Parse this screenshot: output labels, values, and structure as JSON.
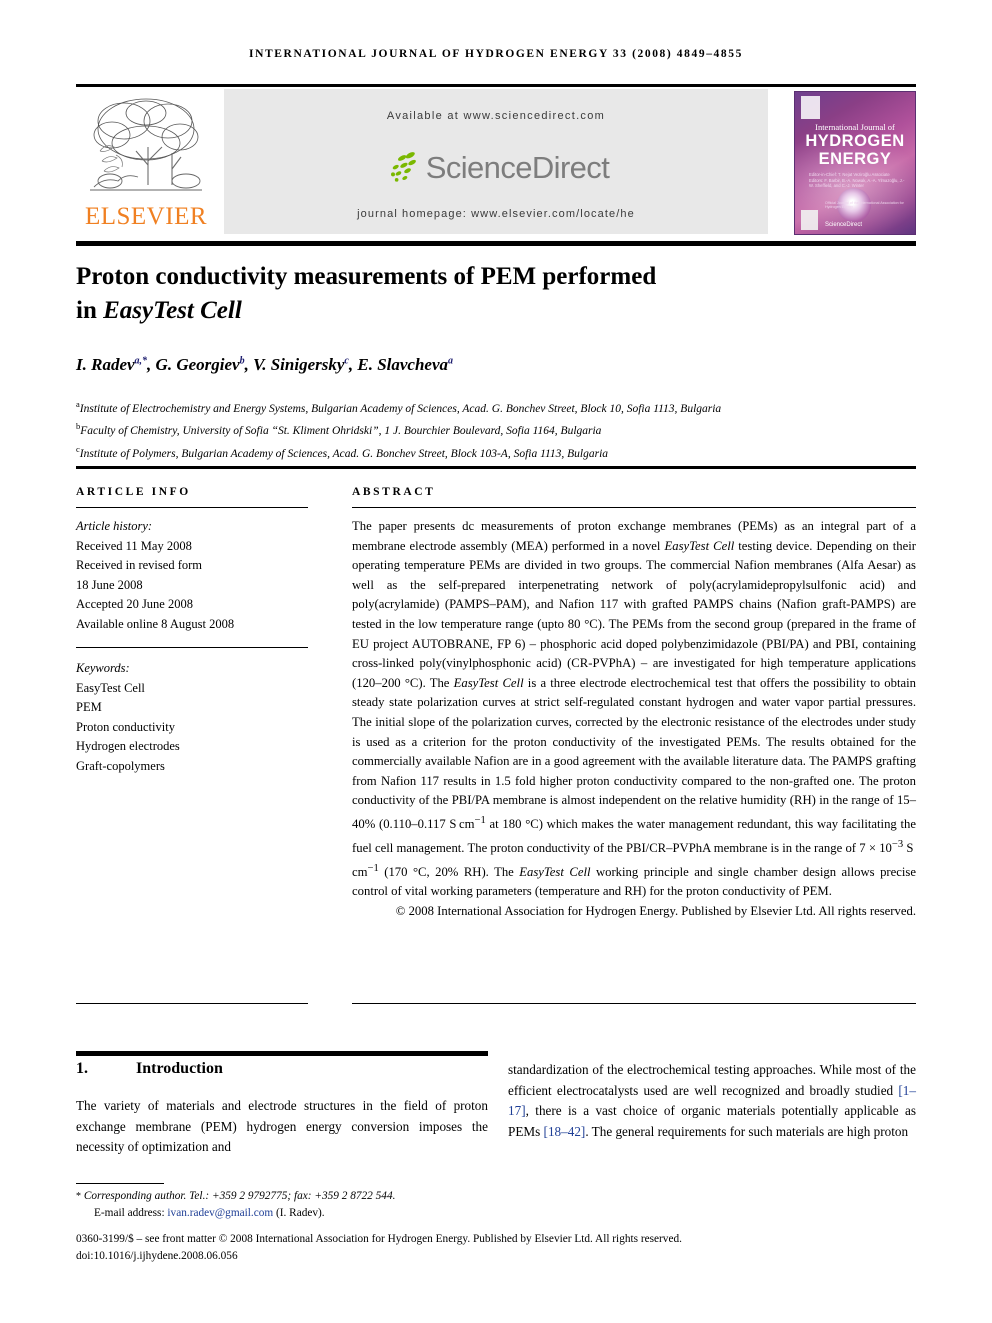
{
  "running_head": "International Journal of Hydrogen Energy 33 (2008) 4849–4855",
  "masthead": {
    "available_at": "Available at www.sciencedirect.com",
    "sciencedirect_logo_text": "ScienceDirect",
    "journal_homepage": "journal homepage: www.elsevier.com/locate/he",
    "publisher_logo_text": "ELSEVIER",
    "publisher_accent": "#f08022",
    "cover": {
      "overline": "International Journal of",
      "line1": "HYDROGEN",
      "line2": "ENERGY",
      "editors": "Editor-in-Chief:  T. Nejat Veziroğlu    Associate Editors: F. Barbir, B.-A. Nowak, A.-A. Ylmazoğlu, J.-W. Sheffield, and C.-J. Winter",
      "bottom_note": "Official Journal of the International Association for Hydrogen Energy",
      "bottom_logo_text": "ScienceDirect",
      "background_color": "#8a3f86"
    }
  },
  "article": {
    "title_line1": "Proton conductivity measurements of PEM performed",
    "title_line2_prefix": "in ",
    "title_line2_italic": "EasyTest Cell",
    "authors": [
      {
        "name": "I. Radev",
        "sup": "a,*"
      },
      {
        "name": "G. Georgiev",
        "sup": "b"
      },
      {
        "name": "V. Sinigersky",
        "sup": "c"
      },
      {
        "name": "E. Slavcheva",
        "sup": "a"
      }
    ],
    "affiliations": [
      {
        "marker": "a",
        "text": "Institute of Electrochemistry and Energy Systems, Bulgarian Academy of Sciences, Acad. G. Bonchev Street, Block 10, Sofia 1113, Bulgaria"
      },
      {
        "marker": "b",
        "text": "Faculty of Chemistry, University of Sofia “St. Kliment Ohridski”, 1 J. Bourchier Boulevard, Sofia 1164, Bulgaria"
      },
      {
        "marker": "c",
        "text": "Institute of Polymers, Bulgarian Academy of Sciences, Acad. G. Bonchev Street, Block 103-A, Sofia 1113, Bulgaria"
      }
    ]
  },
  "article_info": {
    "heading": "ARTICLE INFO",
    "history_label": "Article history:",
    "history": [
      "Received 11 May 2008",
      "Received in revised form",
      "18 June 2008",
      "Accepted 20 June 2008",
      "Available online 8 August 2008"
    ],
    "keywords_label": "Keywords:",
    "keywords": [
      "EasyTest Cell",
      "PEM",
      "Proton conductivity",
      "Hydrogen electrodes",
      "Graft-copolymers"
    ]
  },
  "abstract": {
    "heading": "ABSTRACT",
    "part1": "The paper presents dc measurements of proton exchange membranes (PEMs) as an integral part of a membrane electrode assembly (MEA) performed in a novel ",
    "italic1": "EasyTest Cell",
    "part2": " testing device. Depending on their operating temperature PEMs are divided in two groups. The commercial Nafion membranes (Alfa Aesar) as well as the self-prepared interpenetrating network of poly(acrylamidepropylsulfonic acid) and poly(acrylamide) (PAMPS–PAM), and Nafion 117 with grafted PAMPS chains (Nafion graft-PAMPS) are tested in the low temperature range (upto 80 °C). The PEMs from the second group (prepared in the frame of EU project AUTOBRANE, FP 6) – phosphoric acid doped polybenzimidazole (PBI/PA) and PBI, containing cross-linked poly(vinylphosphonic acid) (CR-PVPhA) – are investigated for high temperature applications (120–200 °C). The ",
    "italic2": "EasyTest Cell",
    "part3": " is a three electrode electrochemical test that offers the possibility to obtain steady state polarization curves at strict self-regulated constant hydrogen and water vapor partial pressures. The initial slope of the polarization curves, corrected by the electronic resistance of the electrodes under study is used as a criterion for the proton conductivity of the investigated PEMs. The results obtained for the commercially available Nafion are in a good agreement with the available literature data. The PAMPS grafting from Nafion 117 results in 1.5 fold higher proton conductivity compared to the non-grafted one. The proton conductivity of the PBI/PA membrane is almost independent on the relative humidity (RH) in the range of 15–40% (0.110–0.117 S cm",
    "exp1": "−1",
    "part4": " at 180 °C) which makes the water management redundant, this way facilitating the fuel cell management. The proton conductivity of the PBI/CR–PVPhA membrane is in the range of 7 × 10",
    "exp2": "−3",
    "part5": " S cm",
    "exp3": "−1",
    "part6": " (170 °C, 20% RH). The ",
    "italic3": "EasyTest Cell",
    "part7": " working principle and single chamber design allows precise control of vital working parameters (temperature and RH) for the proton conductivity of PEM.",
    "copyright": "© 2008 International Association for Hydrogen Energy. Published by Elsevier Ltd. All rights reserved."
  },
  "body": {
    "section_number": "1.",
    "section_title": "Introduction",
    "left_paragraph": "The variety of materials and electrode structures in the field of proton exchange membrane (PEM) hydrogen energy conversion imposes the necessity of optimization and",
    "right_part1": "standardization of the electrochemical testing approaches. While most of the efficient electrocatalysts used are well recognized and broadly studied ",
    "right_cite1": "[1–17]",
    "right_part2": ", there is a vast choice of organic materials potentially applicable as PEMs ",
    "right_cite2": "[18–42]",
    "right_part3": ". The general requirements for such materials are high proton",
    "citation_color": "#1f3f96"
  },
  "footer": {
    "corresponding_star": "*",
    "corresponding": "Corresponding author. Tel.: +359 2 9792775; fax: +359 2 8722 544.",
    "email_label": "E-mail address: ",
    "email": "ivan.radev@gmail.com",
    "email_owner": " (I. Radev).",
    "issn_line": "0360-3199/$ – see front matter © 2008 International Association for Hydrogen Energy. Published by Elsevier Ltd. All rights reserved.",
    "doi_line": "doi:10.1016/j.ijhydene.2008.06.056",
    "link_color": "#1f3f96"
  }
}
